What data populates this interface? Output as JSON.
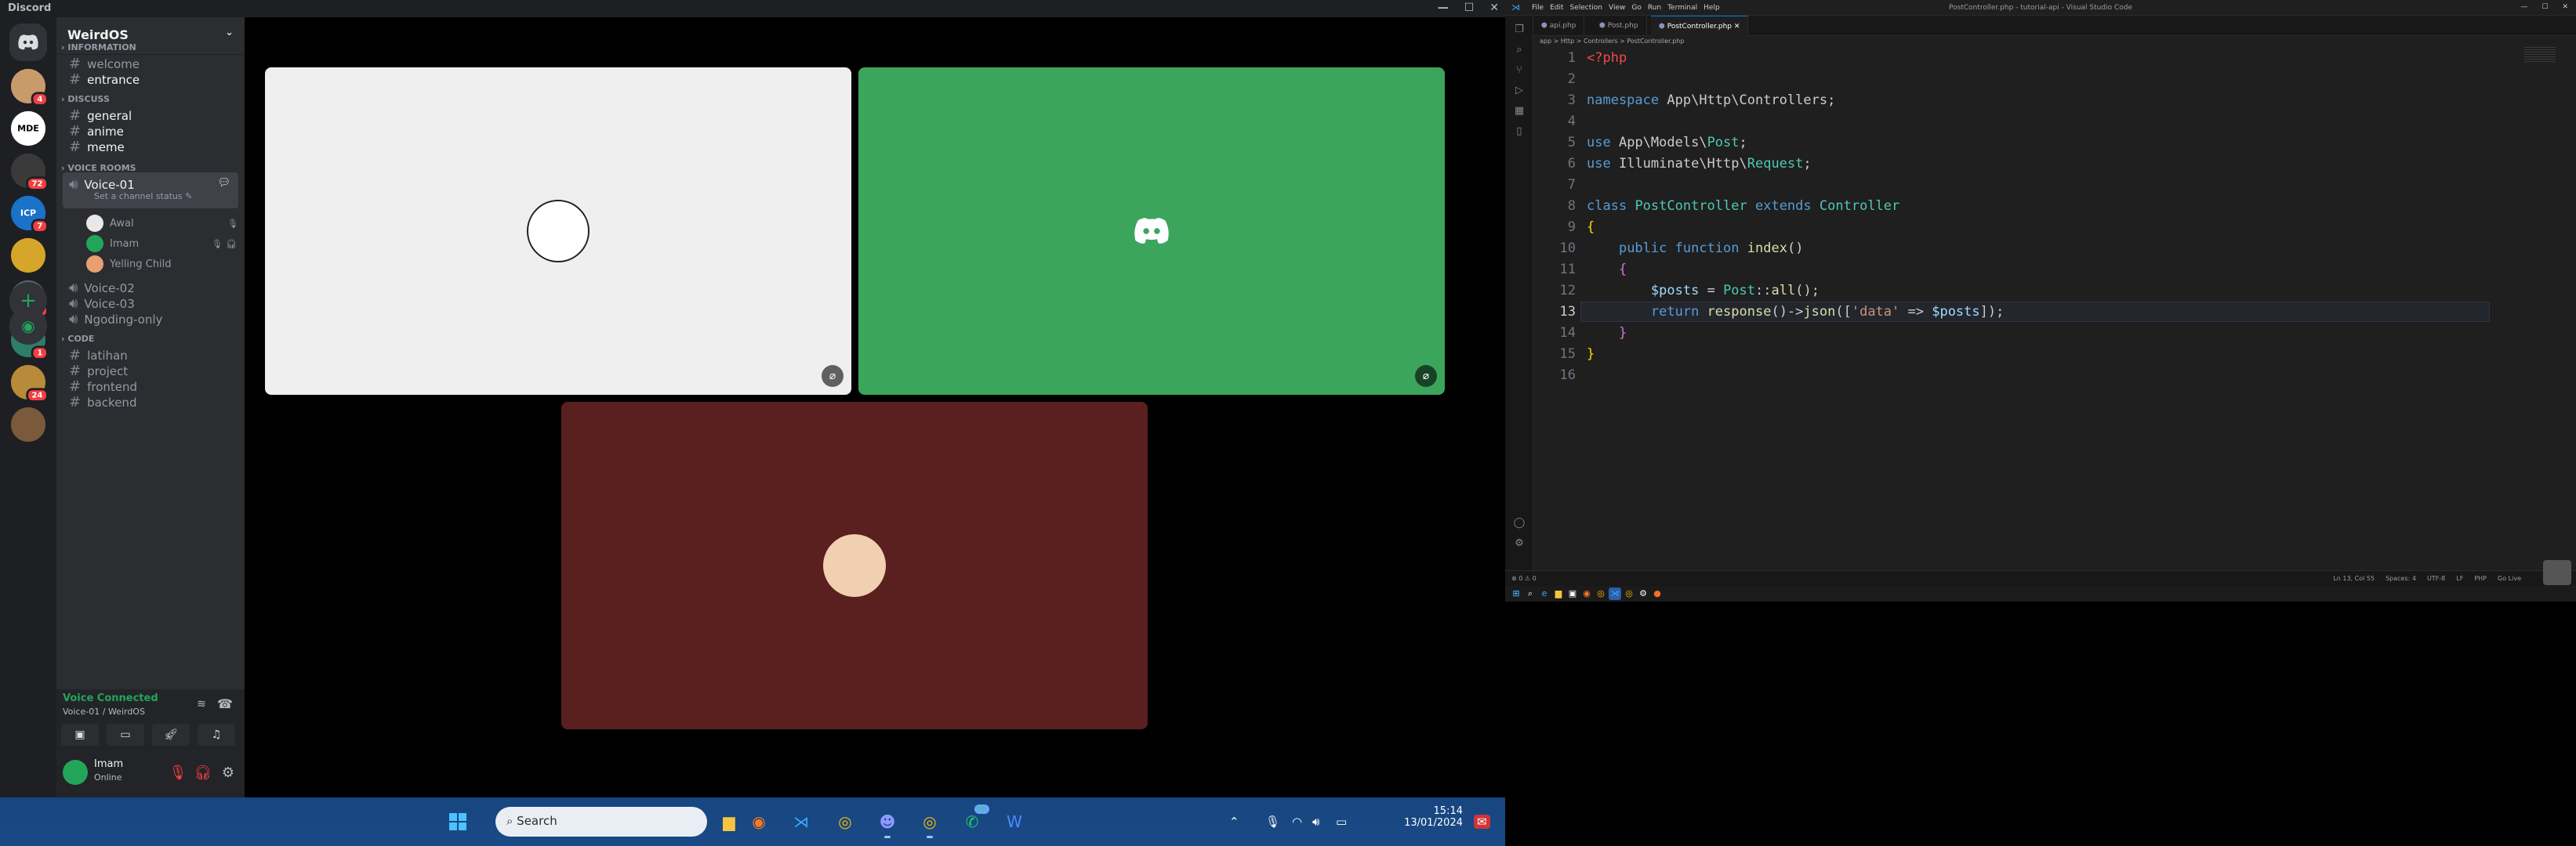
{
  "discord": {
    "app_title": "Discord",
    "guild_name": "WeirdOS",
    "servers": [
      {
        "label": "",
        "badge": "4",
        "color": "#c89b6b"
      },
      {
        "label": "MDE",
        "badge": "",
        "color": "#ffffff"
      },
      {
        "label": "",
        "badge": "72",
        "color": "#3a3a3a"
      },
      {
        "label": "ICP",
        "badge": "7",
        "color": "#1a72c9"
      },
      {
        "label": "",
        "badge": "",
        "color": "#d6a62b"
      },
      {
        "label": "",
        "badge": "75",
        "color": "#5b6470"
      },
      {
        "label": "",
        "badge": "1",
        "color": "#2e7d6a"
      },
      {
        "label": "",
        "badge": "24",
        "color": "#b88b3a"
      },
      {
        "label": "",
        "badge": "",
        "color": "#7a5a3a"
      }
    ],
    "categories": {
      "information": "INFORMATION",
      "discuss": "DISCUSS",
      "voice_rooms": "VOICE ROOMS",
      "code": "CODE"
    },
    "channels": {
      "information": [
        "welcome",
        "entrance"
      ],
      "discuss": [
        "general",
        "anime",
        "meme"
      ],
      "voice": [
        "Voice-01",
        "Voice-02",
        "Voice-03",
        "Ngoding-only"
      ],
      "code": [
        "latihan",
        "project",
        "frontend",
        "backend"
      ]
    },
    "voice_status": "Set a channel status",
    "voice_users": [
      "Awal",
      "Imam",
      "Yelling Child"
    ],
    "voice_connected": "Voice Connected",
    "voice_location": "Voice-01 / WeirdOS",
    "user": {
      "name": "Imam",
      "status": "Online"
    },
    "tiles": [
      {
        "bg": "#efefef",
        "ava": "#222222"
      },
      {
        "bg": "#3ba55c",
        "ava": "#ffffff"
      },
      {
        "bg": "#5a1f1f",
        "ava": "#f0d0b0"
      }
    ]
  },
  "taskbar": {
    "search_placeholder": "Search",
    "time": "15:14",
    "date": "13/01/2024",
    "whatsapp_badge": "46"
  },
  "vscode": {
    "title": "PostController.php - tutorial-api - Visual Studio Code",
    "menu": [
      "File",
      "Edit",
      "Selection",
      "View",
      "Go",
      "Run",
      "Terminal",
      "Help"
    ],
    "tabs": [
      "api.php",
      "Post.php",
      "PostController.php"
    ],
    "breadcrumb": "app > Http > Controllers > PostController.php",
    "status_left": "⊗ 0 ⚠ 0",
    "status_right": [
      "Ln 13, Col 55",
      "Spaces: 4",
      "UTF-8",
      "LF",
      "PHP",
      "Go Live"
    ]
  }
}
